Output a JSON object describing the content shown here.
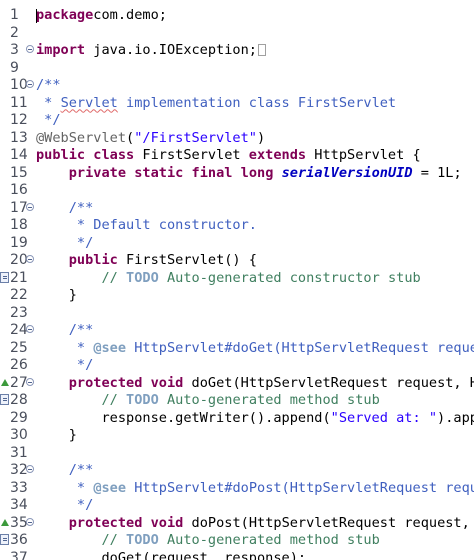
{
  "editor": {
    "lines": [
      {
        "n": "1",
        "seg": [
          [
            "kw",
            "package"
          ],
          [
            "",
            "com.demo;"
          ]
        ]
      },
      {
        "n": "2",
        "seg": []
      },
      {
        "n": "3",
        "fold": true,
        "seg": [
          [
            "kw",
            "import"
          ],
          [
            "",
            " java.io.IOException;"
          ]
        ],
        "collapsed": true
      },
      {
        "n": "9",
        "seg": []
      },
      {
        "n": "10",
        "fold": true,
        "seg": [
          [
            "jdoc",
            "/**"
          ]
        ]
      },
      {
        "n": "11",
        "seg": [
          [
            "jdoc",
            " * "
          ],
          [
            "jdoc squig",
            "Servlet"
          ],
          [
            "jdoc",
            " implementation class FirstServlet"
          ]
        ]
      },
      {
        "n": "12",
        "seg": [
          [
            "jdoc",
            " */"
          ]
        ]
      },
      {
        "n": "13",
        "seg": [
          [
            "ann",
            "@WebServlet"
          ],
          [
            "",
            "("
          ],
          [
            "str",
            "\"/FirstServlet\""
          ],
          [
            "",
            ")"
          ]
        ]
      },
      {
        "n": "14",
        "seg": [
          [
            "kw",
            "public"
          ],
          [
            "",
            " "
          ],
          [
            "kw",
            "class"
          ],
          [
            "",
            " FirstServlet "
          ],
          [
            "kw",
            "extends"
          ],
          [
            "",
            " HttpServlet {"
          ]
        ]
      },
      {
        "n": "15",
        "seg": [
          [
            "",
            "    "
          ],
          [
            "kw",
            "private"
          ],
          [
            "",
            " "
          ],
          [
            "kw",
            "static"
          ],
          [
            "",
            " "
          ],
          [
            "kw",
            "final"
          ],
          [
            "",
            " "
          ],
          [
            "kw",
            "long"
          ],
          [
            "",
            " "
          ],
          [
            "field",
            "serialVersionUID"
          ],
          [
            "",
            " = 1L;"
          ]
        ]
      },
      {
        "n": "16",
        "seg": []
      },
      {
        "n": "17",
        "fold": true,
        "seg": [
          [
            "",
            "    "
          ],
          [
            "jdoc",
            "/**"
          ]
        ]
      },
      {
        "n": "18",
        "seg": [
          [
            "",
            "    "
          ],
          [
            "jdoc",
            " * Default constructor."
          ]
        ]
      },
      {
        "n": "19",
        "seg": [
          [
            "",
            "    "
          ],
          [
            "jdoc",
            " */"
          ]
        ]
      },
      {
        "n": "20",
        "fold": true,
        "seg": [
          [
            "",
            "    "
          ],
          [
            "kw",
            "public"
          ],
          [
            "",
            " FirstServlet() {"
          ]
        ]
      },
      {
        "n": "21",
        "task": true,
        "seg": [
          [
            "",
            "        "
          ],
          [
            "com",
            "// "
          ],
          [
            "todo",
            "TODO"
          ],
          [
            "com",
            " Auto-generated constructor stub"
          ]
        ]
      },
      {
        "n": "22",
        "seg": [
          [
            "",
            "    }"
          ]
        ]
      },
      {
        "n": "23",
        "seg": []
      },
      {
        "n": "24",
        "fold": true,
        "seg": [
          [
            "",
            "    "
          ],
          [
            "jdoc",
            "/**"
          ]
        ]
      },
      {
        "n": "25",
        "seg": [
          [
            "",
            "    "
          ],
          [
            "jdoc",
            " * "
          ],
          [
            "tag",
            "@see"
          ],
          [
            "jdoc",
            " HttpServlet#doGet(HttpServletRequest request, HttpServletResponse response)"
          ]
        ]
      },
      {
        "n": "26",
        "seg": [
          [
            "",
            "    "
          ],
          [
            "jdoc",
            " */"
          ]
        ]
      },
      {
        "n": "27",
        "fold": true,
        "override": true,
        "seg": [
          [
            "",
            "    "
          ],
          [
            "kw",
            "protected"
          ],
          [
            "",
            " "
          ],
          [
            "kw",
            "void"
          ],
          [
            "",
            " doGet(HttpServletRequest request, HttpServletResponse response) throws ServletException, IOException {"
          ]
        ]
      },
      {
        "n": "28",
        "task": true,
        "seg": [
          [
            "",
            "        "
          ],
          [
            "com",
            "// "
          ],
          [
            "todo",
            "TODO"
          ],
          [
            "com",
            " Auto-generated method stub"
          ]
        ]
      },
      {
        "n": "29",
        "seg": [
          [
            "",
            "        response.getWriter().append("
          ],
          [
            "str",
            "\"Served at: \""
          ],
          [
            "",
            ").append(request.getContextPath());"
          ]
        ]
      },
      {
        "n": "30",
        "seg": [
          [
            "",
            "    }"
          ]
        ]
      },
      {
        "n": "31",
        "seg": []
      },
      {
        "n": "32",
        "fold": true,
        "seg": [
          [
            "",
            "    "
          ],
          [
            "jdoc",
            "/**"
          ]
        ]
      },
      {
        "n": "33",
        "seg": [
          [
            "",
            "    "
          ],
          [
            "jdoc",
            " * "
          ],
          [
            "tag",
            "@see"
          ],
          [
            "jdoc",
            " HttpServlet#doPost(HttpServletRequest request, HttpServletResponse response)"
          ]
        ]
      },
      {
        "n": "34",
        "seg": [
          [
            "",
            "    "
          ],
          [
            "jdoc",
            " */"
          ]
        ]
      },
      {
        "n": "35",
        "fold": true,
        "override": true,
        "seg": [
          [
            "",
            "    "
          ],
          [
            "kw",
            "protected"
          ],
          [
            "",
            " "
          ],
          [
            "kw",
            "void"
          ],
          [
            "",
            " doPost(HttpServletRequest request, HttpServletResponse response) throws ServletException, IOException {"
          ]
        ]
      },
      {
        "n": "36",
        "task": true,
        "seg": [
          [
            "",
            "        "
          ],
          [
            "com",
            "// "
          ],
          [
            "todo",
            "TODO"
          ],
          [
            "com",
            " Auto-generated method stub"
          ]
        ]
      },
      {
        "n": "37",
        "seg": [
          [
            "",
            "        doGet(request, response);"
          ]
        ]
      }
    ]
  },
  "colors": {
    "keyword": "#7f0055",
    "javadoc": "#3f5fbf",
    "comment": "#3f7f5f",
    "string": "#2a00ff",
    "field": "#0000c0"
  }
}
